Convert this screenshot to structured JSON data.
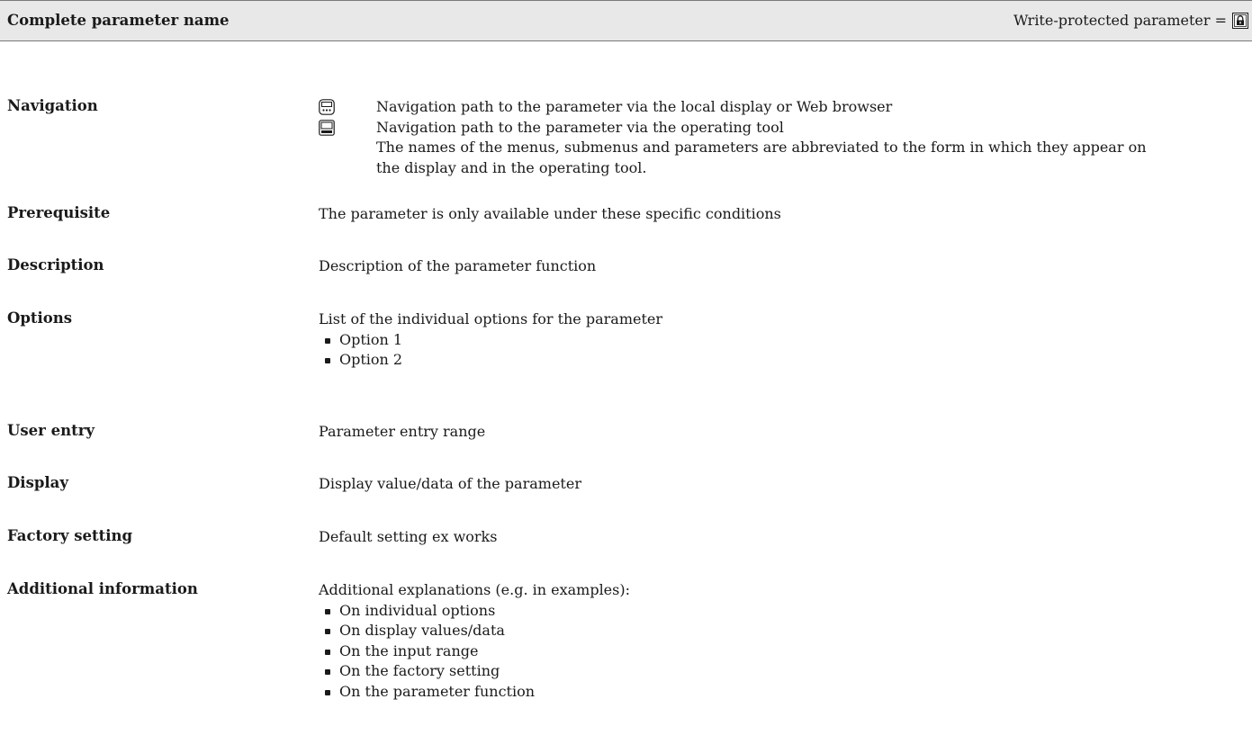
{
  "header": {
    "title": "Complete parameter name",
    "write_protected_label": "Write-protected parameter ="
  },
  "icons": {
    "lock": "lock-icon",
    "local_display": "local-display-icon",
    "operating_tool": "operating-tool-icon"
  },
  "navigation": {
    "label": "Navigation",
    "local_display_path": "Navigation path to the parameter via the local display or Web browser",
    "operating_tool_path": "Navigation path to the parameter via the operating tool",
    "note_line1": "The names of the menus, submenus and parameters are abbreviated to the form in which they appear on",
    "note_line2": "the display and in the operating tool."
  },
  "prerequisite": {
    "label": "Prerequisite",
    "text": "The parameter is only available under these specific conditions"
  },
  "description": {
    "label": "Description",
    "text": "Description of the parameter function"
  },
  "options": {
    "label": "Options",
    "intro": "List of the individual options for the parameter",
    "items": [
      "Option 1",
      "Option 2"
    ]
  },
  "user_entry": {
    "label": "User entry",
    "text": "Parameter entry range"
  },
  "display": {
    "label": "Display",
    "text": "Display value/data of the parameter"
  },
  "factory_setting": {
    "label": "Factory setting",
    "text": "Default setting ex works"
  },
  "additional_information": {
    "label": "Additional information",
    "intro": "Additional explanations (e.g. in examples):",
    "items": [
      "On individual options",
      "On display values/data",
      "On the input range",
      "On the factory setting",
      "On the parameter function"
    ]
  }
}
